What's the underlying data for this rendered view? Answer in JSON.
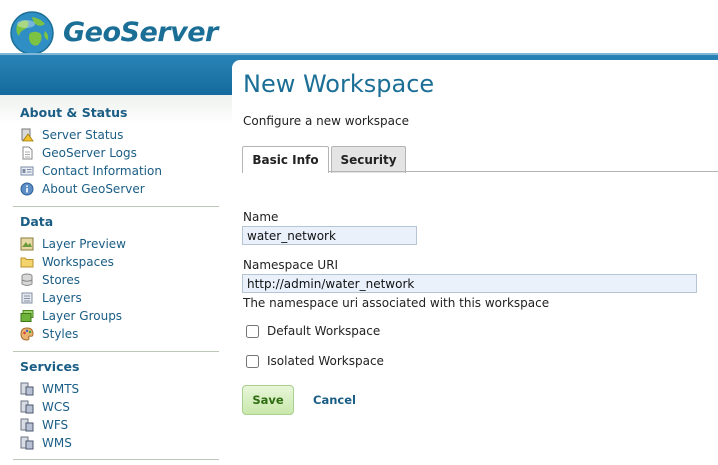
{
  "header": {
    "brand": "GeoServer",
    "logo_icon": "globe-logo-icon"
  },
  "colors": {
    "brand_blue": "#1b6f96",
    "band_blue": "#1a72a6",
    "link_blue": "#1a5d85",
    "save_green": "#c9e8ac"
  },
  "sidebar": {
    "sections": [
      {
        "title": "About & Status",
        "items": [
          {
            "label": "Server Status",
            "icon": "server-status-icon"
          },
          {
            "label": "GeoServer Logs",
            "icon": "document-icon"
          },
          {
            "label": "Contact Information",
            "icon": "contact-card-icon"
          },
          {
            "label": "About GeoServer",
            "icon": "info-icon"
          }
        ]
      },
      {
        "title": "Data",
        "items": [
          {
            "label": "Layer Preview",
            "icon": "map-preview-icon"
          },
          {
            "label": "Workspaces",
            "icon": "folder-icon"
          },
          {
            "label": "Stores",
            "icon": "database-icon"
          },
          {
            "label": "Layers",
            "icon": "layers-icon"
          },
          {
            "label": "Layer Groups",
            "icon": "layer-group-icon"
          },
          {
            "label": "Styles",
            "icon": "palette-icon"
          }
        ]
      },
      {
        "title": "Services",
        "items": [
          {
            "label": "WMTS",
            "icon": "service-icon"
          },
          {
            "label": "WCS",
            "icon": "service-icon"
          },
          {
            "label": "WFS",
            "icon": "service-icon"
          },
          {
            "label": "WMS",
            "icon": "service-icon"
          }
        ]
      }
    ]
  },
  "main": {
    "title": "New Workspace",
    "description": "Configure a new workspace",
    "tabs": [
      {
        "label": "Basic Info",
        "active": true
      },
      {
        "label": "Security",
        "active": false
      }
    ],
    "form": {
      "name_label": "Name",
      "name_value": "water_network",
      "uri_label": "Namespace URI",
      "uri_value": "http://admin/water_network",
      "uri_hint": "The namespace uri associated with this workspace",
      "default_label": "Default Workspace",
      "default_checked": false,
      "isolated_label": "Isolated Workspace",
      "isolated_checked": false
    },
    "actions": {
      "save_label": "Save",
      "cancel_label": "Cancel"
    }
  }
}
